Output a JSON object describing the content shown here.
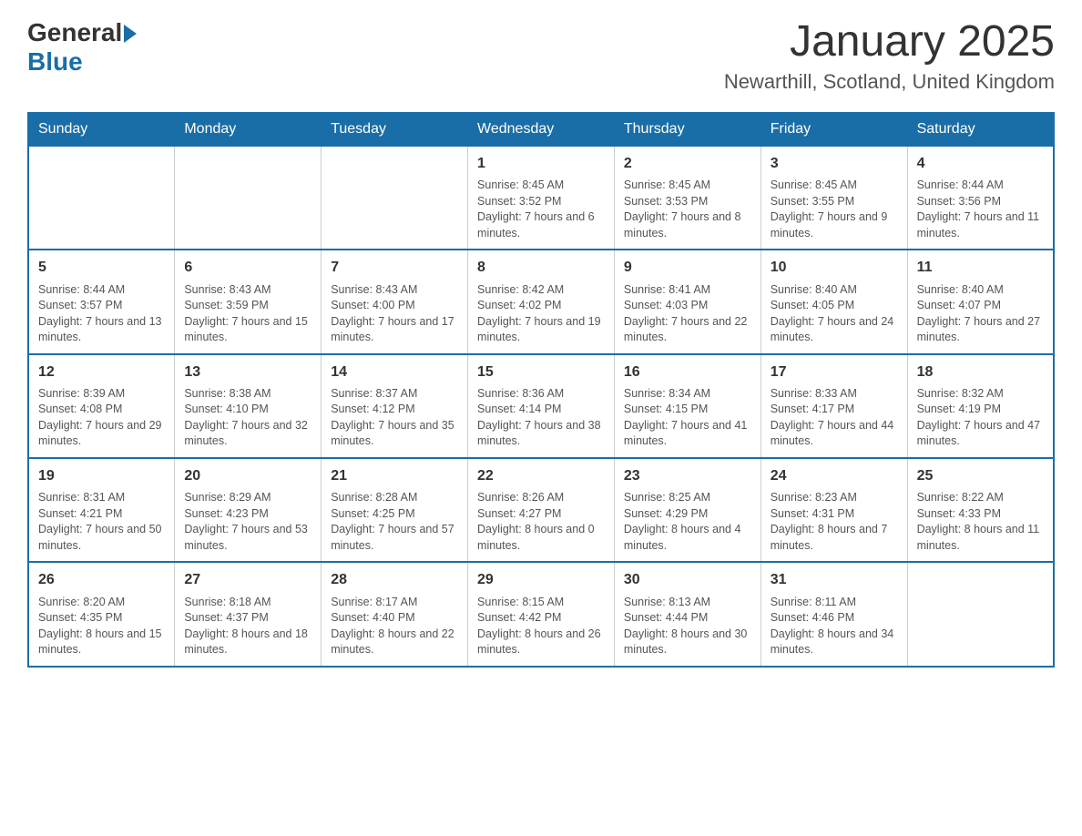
{
  "header": {
    "logo_general": "General",
    "logo_blue": "Blue",
    "month_title": "January 2025",
    "location": "Newarthill, Scotland, United Kingdom"
  },
  "weekdays": [
    "Sunday",
    "Monday",
    "Tuesday",
    "Wednesday",
    "Thursday",
    "Friday",
    "Saturday"
  ],
  "weeks": [
    [
      {
        "day": "",
        "info": ""
      },
      {
        "day": "",
        "info": ""
      },
      {
        "day": "",
        "info": ""
      },
      {
        "day": "1",
        "info": "Sunrise: 8:45 AM\nSunset: 3:52 PM\nDaylight: 7 hours and 6 minutes."
      },
      {
        "day": "2",
        "info": "Sunrise: 8:45 AM\nSunset: 3:53 PM\nDaylight: 7 hours and 8 minutes."
      },
      {
        "day": "3",
        "info": "Sunrise: 8:45 AM\nSunset: 3:55 PM\nDaylight: 7 hours and 9 minutes."
      },
      {
        "day": "4",
        "info": "Sunrise: 8:44 AM\nSunset: 3:56 PM\nDaylight: 7 hours and 11 minutes."
      }
    ],
    [
      {
        "day": "5",
        "info": "Sunrise: 8:44 AM\nSunset: 3:57 PM\nDaylight: 7 hours and 13 minutes."
      },
      {
        "day": "6",
        "info": "Sunrise: 8:43 AM\nSunset: 3:59 PM\nDaylight: 7 hours and 15 minutes."
      },
      {
        "day": "7",
        "info": "Sunrise: 8:43 AM\nSunset: 4:00 PM\nDaylight: 7 hours and 17 minutes."
      },
      {
        "day": "8",
        "info": "Sunrise: 8:42 AM\nSunset: 4:02 PM\nDaylight: 7 hours and 19 minutes."
      },
      {
        "day": "9",
        "info": "Sunrise: 8:41 AM\nSunset: 4:03 PM\nDaylight: 7 hours and 22 minutes."
      },
      {
        "day": "10",
        "info": "Sunrise: 8:40 AM\nSunset: 4:05 PM\nDaylight: 7 hours and 24 minutes."
      },
      {
        "day": "11",
        "info": "Sunrise: 8:40 AM\nSunset: 4:07 PM\nDaylight: 7 hours and 27 minutes."
      }
    ],
    [
      {
        "day": "12",
        "info": "Sunrise: 8:39 AM\nSunset: 4:08 PM\nDaylight: 7 hours and 29 minutes."
      },
      {
        "day": "13",
        "info": "Sunrise: 8:38 AM\nSunset: 4:10 PM\nDaylight: 7 hours and 32 minutes."
      },
      {
        "day": "14",
        "info": "Sunrise: 8:37 AM\nSunset: 4:12 PM\nDaylight: 7 hours and 35 minutes."
      },
      {
        "day": "15",
        "info": "Sunrise: 8:36 AM\nSunset: 4:14 PM\nDaylight: 7 hours and 38 minutes."
      },
      {
        "day": "16",
        "info": "Sunrise: 8:34 AM\nSunset: 4:15 PM\nDaylight: 7 hours and 41 minutes."
      },
      {
        "day": "17",
        "info": "Sunrise: 8:33 AM\nSunset: 4:17 PM\nDaylight: 7 hours and 44 minutes."
      },
      {
        "day": "18",
        "info": "Sunrise: 8:32 AM\nSunset: 4:19 PM\nDaylight: 7 hours and 47 minutes."
      }
    ],
    [
      {
        "day": "19",
        "info": "Sunrise: 8:31 AM\nSunset: 4:21 PM\nDaylight: 7 hours and 50 minutes."
      },
      {
        "day": "20",
        "info": "Sunrise: 8:29 AM\nSunset: 4:23 PM\nDaylight: 7 hours and 53 minutes."
      },
      {
        "day": "21",
        "info": "Sunrise: 8:28 AM\nSunset: 4:25 PM\nDaylight: 7 hours and 57 minutes."
      },
      {
        "day": "22",
        "info": "Sunrise: 8:26 AM\nSunset: 4:27 PM\nDaylight: 8 hours and 0 minutes."
      },
      {
        "day": "23",
        "info": "Sunrise: 8:25 AM\nSunset: 4:29 PM\nDaylight: 8 hours and 4 minutes."
      },
      {
        "day": "24",
        "info": "Sunrise: 8:23 AM\nSunset: 4:31 PM\nDaylight: 8 hours and 7 minutes."
      },
      {
        "day": "25",
        "info": "Sunrise: 8:22 AM\nSunset: 4:33 PM\nDaylight: 8 hours and 11 minutes."
      }
    ],
    [
      {
        "day": "26",
        "info": "Sunrise: 8:20 AM\nSunset: 4:35 PM\nDaylight: 8 hours and 15 minutes."
      },
      {
        "day": "27",
        "info": "Sunrise: 8:18 AM\nSunset: 4:37 PM\nDaylight: 8 hours and 18 minutes."
      },
      {
        "day": "28",
        "info": "Sunrise: 8:17 AM\nSunset: 4:40 PM\nDaylight: 8 hours and 22 minutes."
      },
      {
        "day": "29",
        "info": "Sunrise: 8:15 AM\nSunset: 4:42 PM\nDaylight: 8 hours and 26 minutes."
      },
      {
        "day": "30",
        "info": "Sunrise: 8:13 AM\nSunset: 4:44 PM\nDaylight: 8 hours and 30 minutes."
      },
      {
        "day": "31",
        "info": "Sunrise: 8:11 AM\nSunset: 4:46 PM\nDaylight: 8 hours and 34 minutes."
      },
      {
        "day": "",
        "info": ""
      }
    ]
  ]
}
